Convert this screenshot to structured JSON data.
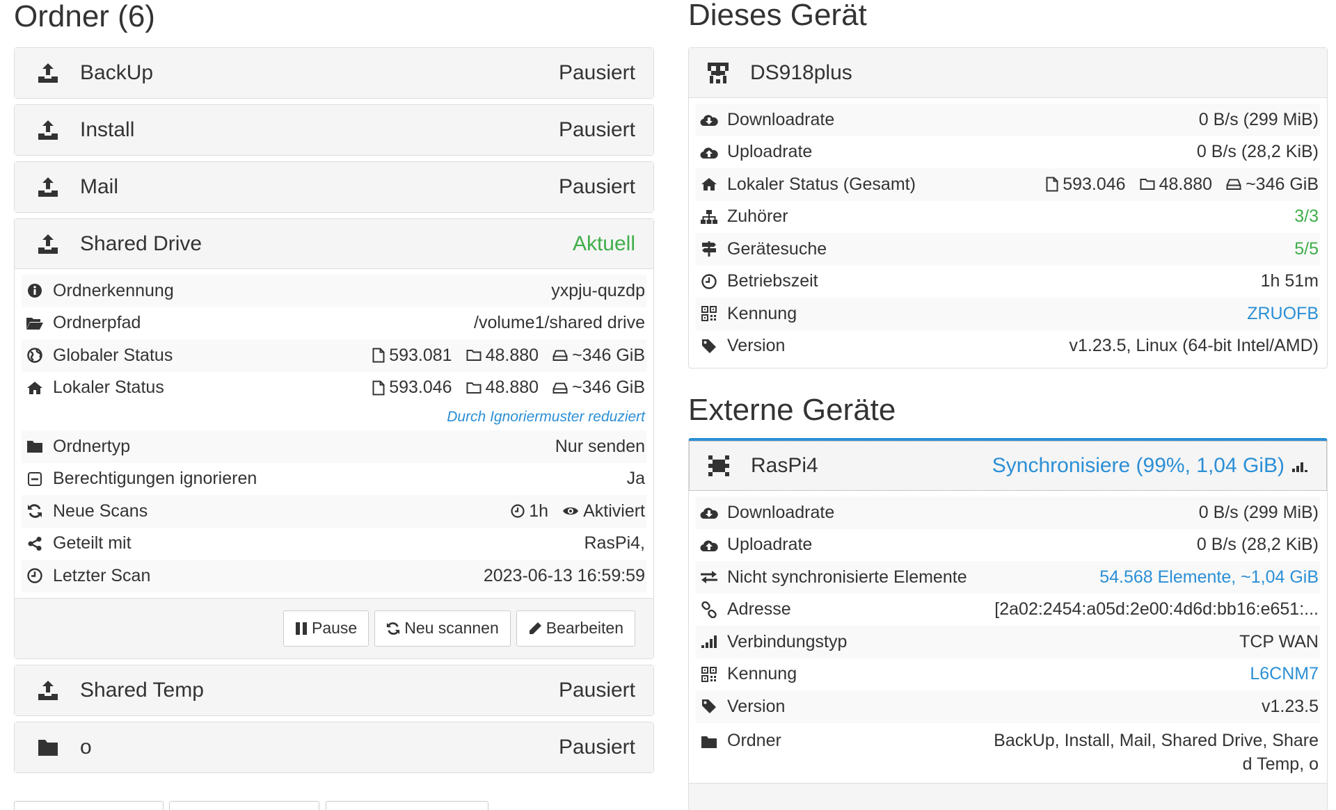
{
  "folders": {
    "title": "Ordner (6)",
    "items": [
      {
        "name": "BackUp",
        "state": "Pausiert"
      },
      {
        "name": "Install",
        "state": "Pausiert"
      },
      {
        "name": "Mail",
        "state": "Pausiert"
      },
      {
        "name": "Shared Drive",
        "state": "Aktuell"
      },
      {
        "name": "Shared Temp",
        "state": "Pausiert"
      },
      {
        "name": "o",
        "state": "Pausiert"
      }
    ],
    "expanded": {
      "folder_id_label": "Ordnerkennung",
      "folder_id_value": "yxpju-quzdp",
      "path_label": "Ordnerpfad",
      "path_value": "/volume1/shared drive",
      "global_label": "Globaler Status",
      "global_files": "593.081",
      "global_dirs": "48.880",
      "global_size": "~346 GiB",
      "local_label": "Lokaler Status",
      "local_files": "593.046",
      "local_dirs": "48.880",
      "local_size": "~346 GiB",
      "ignore_note": "Durch Ignoriermuster reduziert",
      "type_label": "Ordnertyp",
      "type_value": "Nur senden",
      "perm_label": "Berechtigungen ignorieren",
      "perm_value": "Ja",
      "rescan_label": "Neue Scans",
      "rescan_interval": "1h",
      "rescan_watch": "Aktiviert",
      "shared_label": "Geteilt mit",
      "shared_value": "RasPi4,",
      "lastscan_label": "Letzter Scan",
      "lastscan_value": "2023-06-13 16:59:59",
      "btn_pause": "Pause",
      "btn_rescan": "Neu scannen",
      "btn_edit": "Bearbeiten"
    }
  },
  "this_device": {
    "title": "Dieses Gerät",
    "name": "DS918plus",
    "download_label": "Downloadrate",
    "download_value": "0 B/s (299 MiB)",
    "upload_label": "Uploadrate",
    "upload_value": "0 B/s (28,2 KiB)",
    "local_label": "Lokaler Status (Gesamt)",
    "local_files": "593.046",
    "local_dirs": "48.880",
    "local_size": "~346 GiB",
    "listeners_label": "Zuhörer",
    "listeners_value": "3/3",
    "discovery_label": "Gerätesuche",
    "discovery_value": "5/5",
    "uptime_label": "Betriebszeit",
    "uptime_value": "1h 51m",
    "id_label": "Kennung",
    "id_value": "ZRUOFB",
    "version_label": "Version",
    "version_value": "v1.23.5, Linux (64-bit Intel/AMD)"
  },
  "remote_devices": {
    "title": "Externe Geräte",
    "name": "RasPi4",
    "state": "Synchronisiere (99%, 1,04 GiB)",
    "download_label": "Downloadrate",
    "download_value": "0 B/s (299 MiB)",
    "upload_label": "Uploadrate",
    "upload_value": "0 B/s (28,2 KiB)",
    "outofsync_label": "Nicht synchronisierte Elemente",
    "outofsync_value": "54.568 Elemente, ~1,04 GiB",
    "address_label": "Adresse",
    "address_value": "[2a02:2454:a05d:2e00:4d6d:bb16:e651:...",
    "conntype_label": "Verbindungstyp",
    "conntype_value": "TCP WAN",
    "id_label": "Kennung",
    "id_value": "L6CNM7",
    "version_label": "Version",
    "version_value": "v1.23.5",
    "folders_label": "Ordner",
    "folders_value": "BackUp, Install, Mail, Shared Drive, Share d Temp, o"
  },
  "colors": {
    "green": "#3fae49",
    "blue": "#2b8fd6",
    "panel_bg": "#f5f5f5"
  }
}
